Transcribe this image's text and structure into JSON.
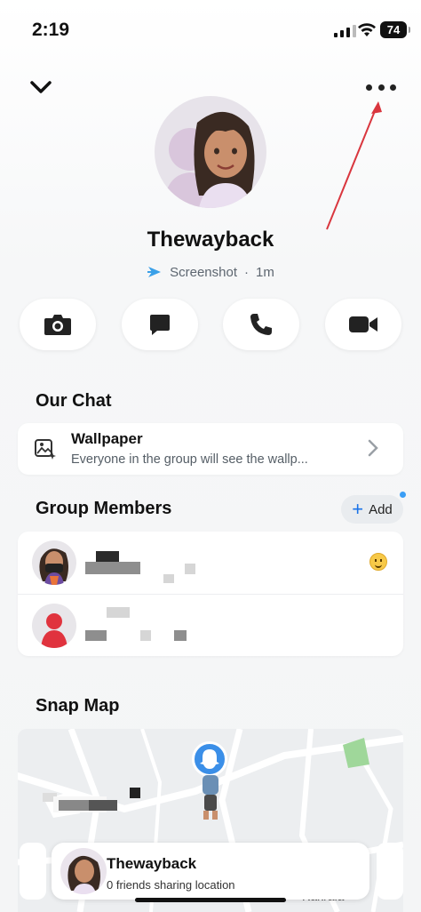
{
  "status_bar": {
    "time": "2:19",
    "battery": "74"
  },
  "profile": {
    "name": "Thewayback",
    "status_text": "Screenshot",
    "status_sep": "·",
    "status_time": "1m"
  },
  "actions": [
    {
      "icon": "camera-icon"
    },
    {
      "icon": "chat-icon"
    },
    {
      "icon": "phone-icon"
    },
    {
      "icon": "video-icon"
    }
  ],
  "our_chat": {
    "title": "Our Chat",
    "wallpaper_title": "Wallpaper",
    "wallpaper_subtitle": "Everyone in the group will see the wallp..."
  },
  "group_members": {
    "title": "Group Members",
    "add_label": "Add"
  },
  "snap_map": {
    "title": "Snap Map",
    "place_label": "Kakrala",
    "card_name": "Thewayback",
    "card_subtitle": "0 friends sharing location"
  },
  "colors": {
    "accent_blue": "#1a73e8",
    "annotation_arrow": "#d9363e"
  }
}
